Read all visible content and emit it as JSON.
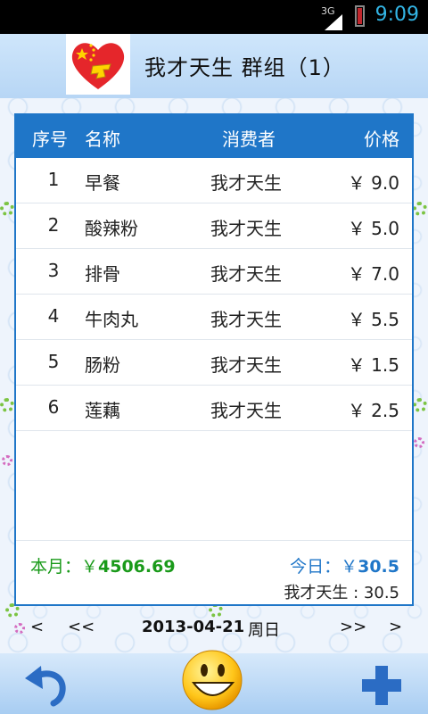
{
  "status_bar": {
    "network": "3G",
    "time": "9:09"
  },
  "header": {
    "title": "我才天生  群组（1）",
    "avatar_icon": "heart-flag-icon"
  },
  "table": {
    "headers": {
      "no": "序号",
      "name": "名称",
      "consumer": "消费者",
      "price": "价格"
    },
    "rows": [
      {
        "no": "1",
        "name": "早餐",
        "consumer": "我才天生",
        "price": "￥ 9.0"
      },
      {
        "no": "2",
        "name": "酸辣粉",
        "consumer": "我才天生",
        "price": "￥ 5.0"
      },
      {
        "no": "3",
        "name": "排骨",
        "consumer": "我才天生",
        "price": "￥ 7.0"
      },
      {
        "no": "4",
        "name": "牛肉丸",
        "consumer": "我才天生",
        "price": "￥ 5.5"
      },
      {
        "no": "5",
        "name": "肠粉",
        "consumer": "我才天生",
        "price": "￥ 1.5"
      },
      {
        "no": "6",
        "name": "莲藕",
        "consumer": "我才天生",
        "price": "￥ 2.5"
      }
    ]
  },
  "summary": {
    "month_label": "本月：￥",
    "month_value": "4506.69",
    "today_label": "今日：￥",
    "today_value": "30.5",
    "user_total": "我才天生 : 30.5"
  },
  "date_nav": {
    "prev": "<",
    "prev_fast": "<<",
    "date": "2013-04-21",
    "weekday": "周日",
    "next_fast": ">>",
    "next": ">"
  },
  "bottom_bar": {
    "undo_icon": "undo-arrow-icon",
    "center_icon": "smiley-face-icon",
    "add_icon": "plus-icon"
  },
  "colors": {
    "accent": "#1f76c8",
    "month_green": "#1a9a1a",
    "header_bg": "#cfe6fb"
  }
}
